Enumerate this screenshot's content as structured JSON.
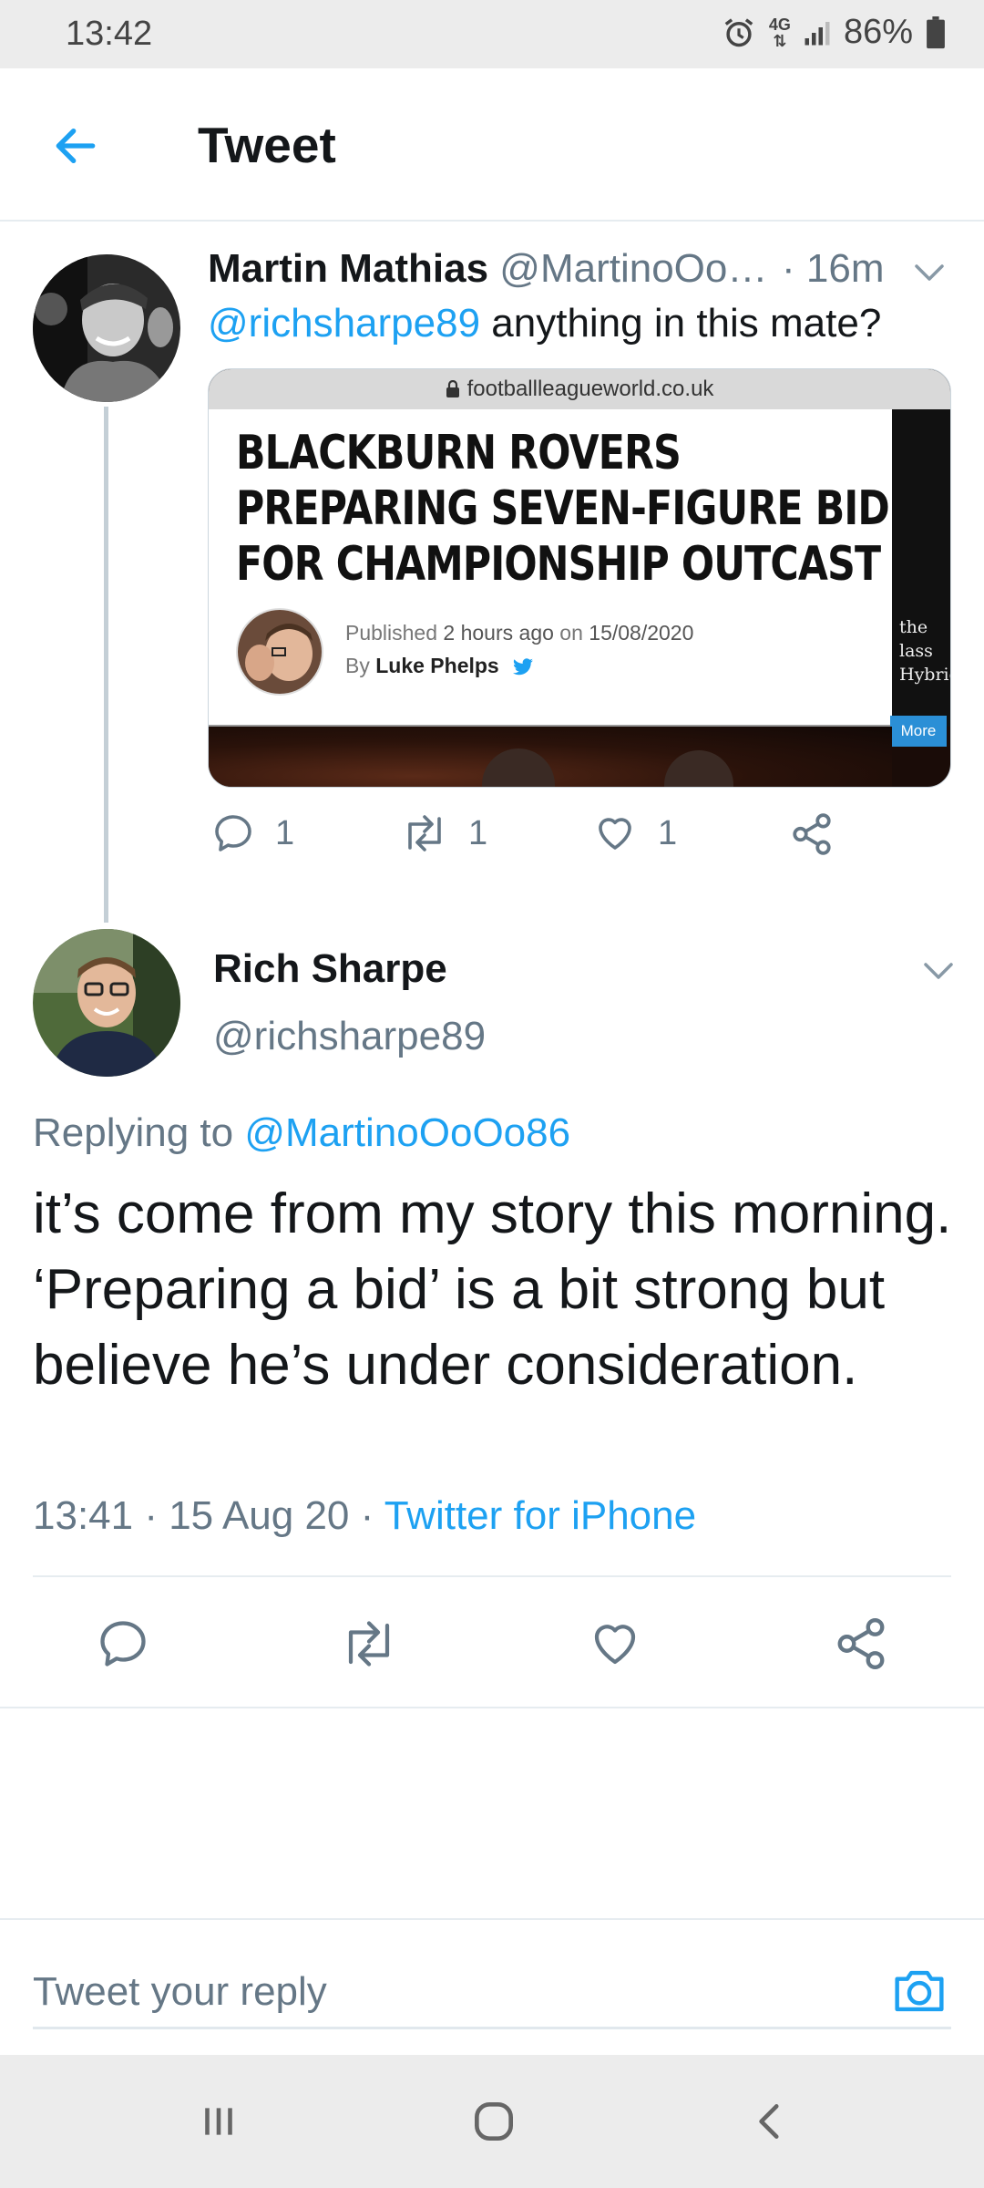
{
  "status_bar": {
    "time": "13:42",
    "network": "4G",
    "battery": "86%",
    "icons": [
      "alarm-icon",
      "network-4g-icon",
      "signal-icon",
      "battery-icon"
    ]
  },
  "header": {
    "title": "Tweet",
    "back_icon": "arrow-left-icon"
  },
  "tweet1": {
    "name": "Martin Mathias",
    "handle": "@MartinoOo…",
    "time": "· 16m",
    "mention": "@richsharpe89",
    "text": " anything in this mate?",
    "card": {
      "domain": "footballleagueworld.co.uk",
      "headline_line1": "BLACKBURN ROVERS",
      "headline_line2": "PREPARING SEVEN-FIGURE BID",
      "headline_line3": "FOR CHAMPIONSHIP OUTCAST",
      "published_prefix": "Published ",
      "published_ago": "2 hours ago",
      "published_on": " on ",
      "published_date": "15/08/2020",
      "by_prefix": "By ",
      "author": "Luke Phelps",
      "side_line1": "the",
      "side_line2": "lass",
      "side_line3": "Hybrid.",
      "more": "More"
    },
    "reply_count": "1",
    "retweet_count": "1",
    "like_count": "1"
  },
  "tweet2": {
    "name": "Rich Sharpe",
    "handle": "@richsharpe89",
    "replying_label": "Replying to ",
    "replying_handle": "@MartinoOoOo86",
    "body": "it’s come from my story this morning. ‘Preparing a bid’ is a bit strong but believe he’s under consideration.",
    "meta_time": "13:41 · 15 Aug 20 · ",
    "meta_source": "Twitter for iPhone"
  },
  "reply_box": {
    "placeholder": "Tweet your reply"
  },
  "colors": {
    "accent": "#1da1f2",
    "secondary_text": "#657786",
    "divider": "#e6ecf0"
  }
}
